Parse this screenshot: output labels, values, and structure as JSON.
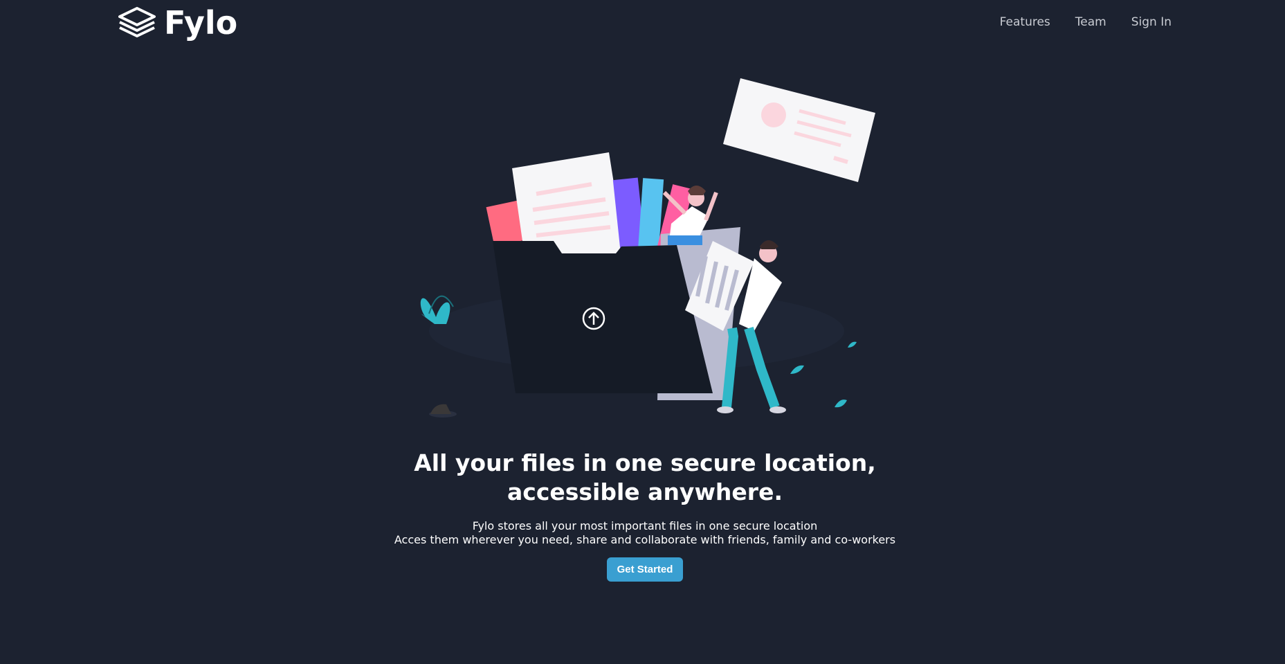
{
  "brand": {
    "name": "Fylo",
    "logo_icon": "layers-icon"
  },
  "nav": {
    "items": [
      {
        "label": "Features"
      },
      {
        "label": "Team"
      },
      {
        "label": "Sign In"
      }
    ]
  },
  "hero": {
    "illustration_icon": "upload-arrow-icon",
    "headline_line1": "All your files in one secure location,",
    "headline_line2": "accessible anywhere.",
    "sub_line1": "Fylo stores all your most important files in one secure location",
    "sub_line2": "Acces them wherever you need, share and collaborate with friends, family and co-workers",
    "cta_label": "Get Started"
  },
  "colors": {
    "background": "#1c2230",
    "accent": "#3a9fd1",
    "nav_text": "#c9ccd3"
  }
}
